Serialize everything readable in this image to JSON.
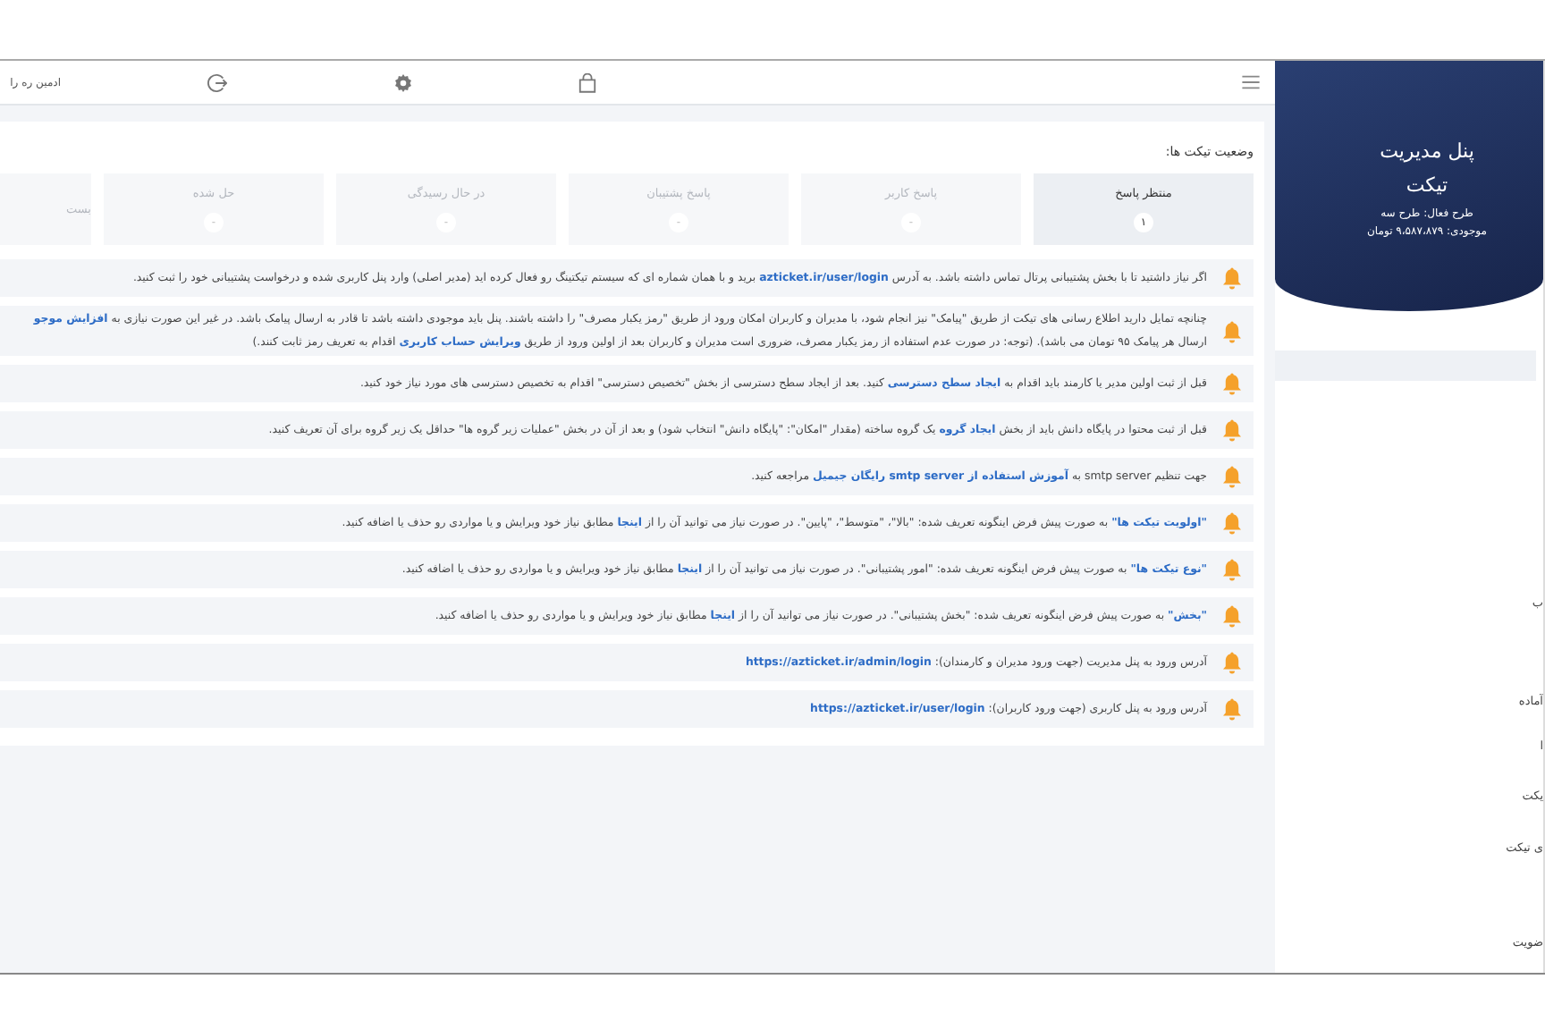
{
  "sidebar": {
    "title": "پنل مدیریت تیکت",
    "plan": "طرح فعال: طرح سه",
    "balance": "موجودی: ۹،۵۸۷،۸۷۹ تومان",
    "items": [
      "ب",
      "آماده",
      "ا",
      "یکت",
      "ی تیکت",
      "ضویت"
    ]
  },
  "header": {
    "user": "ادمین ره را"
  },
  "status": {
    "title": "وضعیت تیکت ها:",
    "cards": [
      {
        "label": "منتظر پاسخ",
        "count": "۱",
        "selected": true
      },
      {
        "label": "پاسخ کاربر",
        "count": "-",
        "selected": false
      },
      {
        "label": "پاسخ پشتیبان",
        "count": "-",
        "selected": false
      },
      {
        "label": "در حال رسیدگی",
        "count": "-",
        "selected": false
      },
      {
        "label": "حل شده",
        "count": "-",
        "selected": false
      },
      {
        "label": "بست",
        "selected": false
      }
    ]
  },
  "messages": [
    {
      "lines": [
        [
          {
            "text": "اگر نیاز داشتید تا با بخش پشتیبانی پرتال تماس داشته باشد. به آدرس "
          },
          {
            "text": "azticket.ir/user/login",
            "link": true
          },
          {
            "text": " برید و با همان شماره ای که سیستم تیکتینگ رو فعال کرده اید (مدیر اصلی) وارد پنل کاربری شده و درخواست پشتیبانی خود را ثبت کنید."
          }
        ]
      ]
    },
    {
      "lines": [
        [
          {
            "text": "چنانچه تمایل دارید اطلاع رسانی های تیکت از طریق \"پیامک\" نیز انجام شود، با مدیران و کاربران امکان ورود از طریق \"رمز یکبار مصرف\" را داشته باشند. پنل باید موجودی داشته باشد تا قادر به ارسال پیامک باشد. در غیر این صورت نیازی به "
          },
          {
            "text": "افزایش موجو",
            "link": true
          }
        ],
        [
          {
            "text": "ارسال هر پیامک ۹۵ تومان می باشد). (توجه: در صورت عدم استفاده از رمز یکبار مصرف، ضروری است مدیران و کاربران بعد از اولین ورود از طریق "
          },
          {
            "text": "ویرایش حساب کاربری",
            "link": true
          },
          {
            "text": " اقدام به تعریف رمز ثابت کنند.)"
          }
        ]
      ]
    },
    {
      "lines": [
        [
          {
            "text": "قبل از ثبت اولین مدیر یا کارمند باید اقدام به "
          },
          {
            "text": "ایجاد سطح دسترسی",
            "link": true
          },
          {
            "text": " کنید. بعد از ایجاد سطح دسترسی از بخش \"تخصیص دسترسی\" اقدام به تخصیص دسترسی های مورد نیاز خود کنید."
          }
        ]
      ]
    },
    {
      "lines": [
        [
          {
            "text": "قبل از ثبت محتوا در پایگاه دانش باید از بخش "
          },
          {
            "text": "ایجاد گروه",
            "link": true
          },
          {
            "text": " یک گروه ساخته (مقدار \"امکان\": \"پایگاه دانش\" انتخاب شود) و بعد از آن در بخش \"عملیات زیر گروه ها\" حداقل یک زیر گروه برای آن تعریف کنید."
          }
        ]
      ]
    },
    {
      "lines": [
        [
          {
            "text": "جهت تنظیم smtp server به "
          },
          {
            "text": "آموزش استفاده از smtp server رایگان جیمیل",
            "link": true
          },
          {
            "text": " مراجعه کنید."
          }
        ]
      ]
    },
    {
      "lines": [
        [
          {
            "text": "\"اولویت تیکت ها\"",
            "link": true
          },
          {
            "text": " به صورت پیش فرض اینگونه تعریف شده: \"بالا\"، \"متوسط\"، \"پایین\". در صورت نیاز می توانید آن را از "
          },
          {
            "text": "اینجا",
            "link": true
          },
          {
            "text": " مطابق نیاز خود ویرایش و یا مواردی رو حذف یا اضافه کنید."
          }
        ]
      ]
    },
    {
      "lines": [
        [
          {
            "text": "\"نوع تیکت ها\"",
            "link": true
          },
          {
            "text": " به صورت پیش فرض اینگونه تعریف شده: \"امور پشتیبانی\". در صورت نیاز می توانید آن را از "
          },
          {
            "text": "اینجا",
            "link": true
          },
          {
            "text": " مطابق نیاز خود ویرایش و یا مواردی رو حذف یا اضافه کنید."
          }
        ]
      ]
    },
    {
      "lines": [
        [
          {
            "text": "\"بخش\"",
            "link": true
          },
          {
            "text": " به صورت پیش فرض اینگونه تعریف شده: \"بخش پشتیبانی\". در صورت نیاز می توانید آن را از "
          },
          {
            "text": "اینجا",
            "link": true
          },
          {
            "text": " مطابق نیاز خود ویرایش و یا مواردی رو حذف یا اضافه کنید."
          }
        ]
      ]
    },
    {
      "lines": [
        [
          {
            "text": "آدرس ورود به پنل مدیریت (جهت ورود مدیران و کارمندان): "
          },
          {
            "text": "https://azticket.ir/admin/login",
            "link": true
          }
        ]
      ]
    },
    {
      "lines": [
        [
          {
            "text": "آدرس ورود به پنل کاربری (جهت ورود کاربران): "
          },
          {
            "text": "https://azticket.ir/user/login",
            "link": true
          }
        ]
      ]
    }
  ]
}
